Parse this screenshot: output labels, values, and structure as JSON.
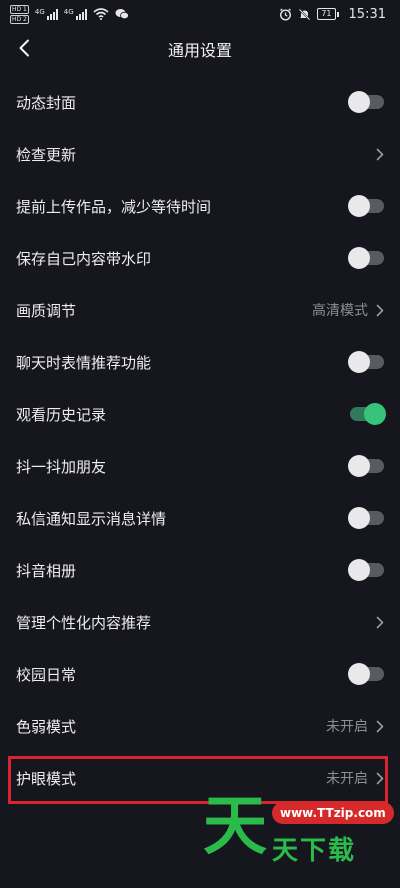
{
  "status": {
    "net_1": "4G",
    "net_2": "4G",
    "battery": "71",
    "time": "15:31"
  },
  "header": {
    "title": "通用设置"
  },
  "settings": [
    {
      "label": "动态封面",
      "control": "toggle",
      "state": "off"
    },
    {
      "label": "检查更新",
      "control": "chevron"
    },
    {
      "label": "提前上传作品，减少等待时间",
      "control": "toggle",
      "state": "off"
    },
    {
      "label": "保存自己内容带水印",
      "control": "toggle",
      "state": "off"
    },
    {
      "label": "画质调节",
      "control": "chevron",
      "value": "高清模式"
    },
    {
      "label": "聊天时表情推荐功能",
      "control": "toggle",
      "state": "off"
    },
    {
      "label": "观看历史记录",
      "control": "toggle",
      "state": "on"
    },
    {
      "label": "抖一抖加朋友",
      "control": "toggle",
      "state": "off"
    },
    {
      "label": "私信通知显示消息详情",
      "control": "toggle",
      "state": "off"
    },
    {
      "label": "抖音相册",
      "control": "toggle",
      "state": "off"
    },
    {
      "label": "管理个性化内容推荐",
      "control": "chevron"
    },
    {
      "label": "校园日常",
      "control": "toggle",
      "state": "off"
    },
    {
      "label": "色弱模式",
      "control": "chevron",
      "value": "未开启"
    },
    {
      "label": "护眼模式",
      "control": "chevron",
      "value": "未开启"
    }
  ],
  "colors": {
    "background": "#16161e",
    "toggle_on": "#37c47a",
    "highlight_border": "#d8262f"
  },
  "watermark": {
    "url": "www.TTzip.com",
    "glyph": "天",
    "tagline": "天下载"
  }
}
